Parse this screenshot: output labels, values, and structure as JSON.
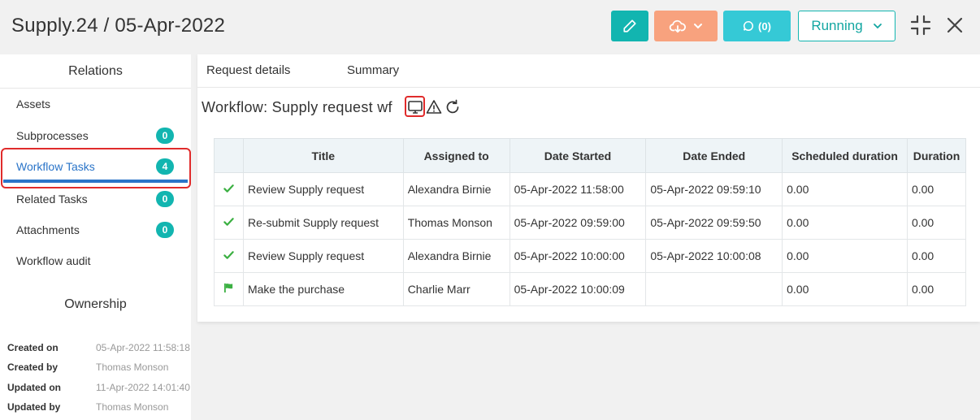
{
  "header": {
    "title": "Supply.24 / 05-Apr-2022",
    "comments_label": "(0)",
    "status_label": "Running",
    "colors": {
      "teal": "#12b5b0",
      "orange": "#f8a27e",
      "cyan": "#35c9d6",
      "accent_blue": "#2a74c8",
      "highlight_red": "#e02b2b"
    }
  },
  "sidebar": {
    "title": "Relations",
    "items": [
      {
        "label": "Assets",
        "badge": null
      },
      {
        "label": "Subprocesses",
        "badge": "0"
      },
      {
        "label": "Workflow Tasks",
        "badge": "4",
        "active": true
      },
      {
        "label": "Related Tasks",
        "badge": "0"
      },
      {
        "label": "Attachments",
        "badge": "0"
      },
      {
        "label": "Workflow audit",
        "badge": null
      }
    ],
    "ownership": {
      "title": "Ownership",
      "created_on_label": "Created on",
      "created_on": "05-Apr-2022 11:58:18",
      "created_by_label": "Created by",
      "created_by": "Thomas Monson",
      "updated_on_label": "Updated on",
      "updated_on": "11-Apr-2022 14:01:40",
      "updated_by_label": "Updated by",
      "updated_by": "Thomas Monson"
    }
  },
  "main": {
    "tabs": [
      {
        "label": "Request details"
      },
      {
        "label": "Summary"
      }
    ],
    "workflow_title": "Workflow: Supply request wf",
    "icons": [
      "monitor-icon",
      "warning-icon",
      "refresh-icon"
    ],
    "table": {
      "columns": [
        "",
        "Title",
        "Assigned to",
        "Date Started",
        "Date Ended",
        "Scheduled duration",
        "Duration"
      ],
      "rows": [
        {
          "status": "completed",
          "title": "Review Supply request",
          "assigned_to": "Alexandra Birnie",
          "date_started": "05-Apr-2022 11:58:00",
          "date_ended": "05-Apr-2022 09:59:10",
          "scheduled_duration": "0.00",
          "duration": "0.00"
        },
        {
          "status": "completed",
          "title": "Re-submit Supply request",
          "assigned_to": "Thomas Monson",
          "date_started": "05-Apr-2022 09:59:00",
          "date_ended": "05-Apr-2022 09:59:50",
          "scheduled_duration": "0.00",
          "duration": "0.00"
        },
        {
          "status": "completed",
          "title": "Review Supply request",
          "assigned_to": "Alexandra Birnie",
          "date_started": "05-Apr-2022 10:00:00",
          "date_ended": "05-Apr-2022 10:00:08",
          "scheduled_duration": "0.00",
          "duration": "0.00"
        },
        {
          "status": "in-progress",
          "title": "Make the purchase",
          "assigned_to": "Charlie Marr",
          "date_started": "05-Apr-2022 10:00:09",
          "date_ended": "",
          "scheduled_duration": "0.00",
          "duration": "0.00"
        }
      ]
    }
  }
}
